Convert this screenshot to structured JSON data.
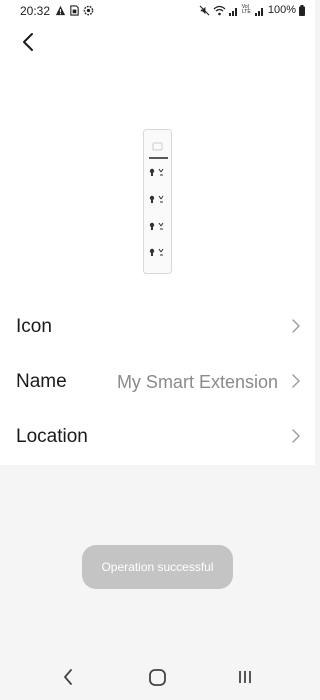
{
  "status_bar": {
    "time": "20:32",
    "left_icons": [
      "warning-icon",
      "sim-card-icon",
      "settings-badge-icon"
    ],
    "right_icons": [
      "mute-icon",
      "wifi-icon",
      "signal-icon-1",
      "signal-icon-2"
    ],
    "volte_label": "Vo)\nLTE",
    "battery_percent": "100%"
  },
  "header": {
    "back_icon": "back-arrow-icon"
  },
  "device": {
    "image": "power-strip-image",
    "outlet_count": 4
  },
  "settings_rows": [
    {
      "label": "Icon",
      "value": ""
    },
    {
      "label": "Name",
      "value": "My Smart Extension"
    },
    {
      "label": "Location",
      "value": ""
    }
  ],
  "toast": {
    "message": "Operation successful"
  },
  "nav_bar": {
    "icons": [
      "nav-back-icon",
      "nav-home-icon",
      "nav-recents-icon"
    ]
  },
  "colors": {
    "page_background": "#f5f5f5",
    "card_background": "#ffffff",
    "value_text": "#8a8a8a",
    "toast_background": "#c4c4c4"
  }
}
